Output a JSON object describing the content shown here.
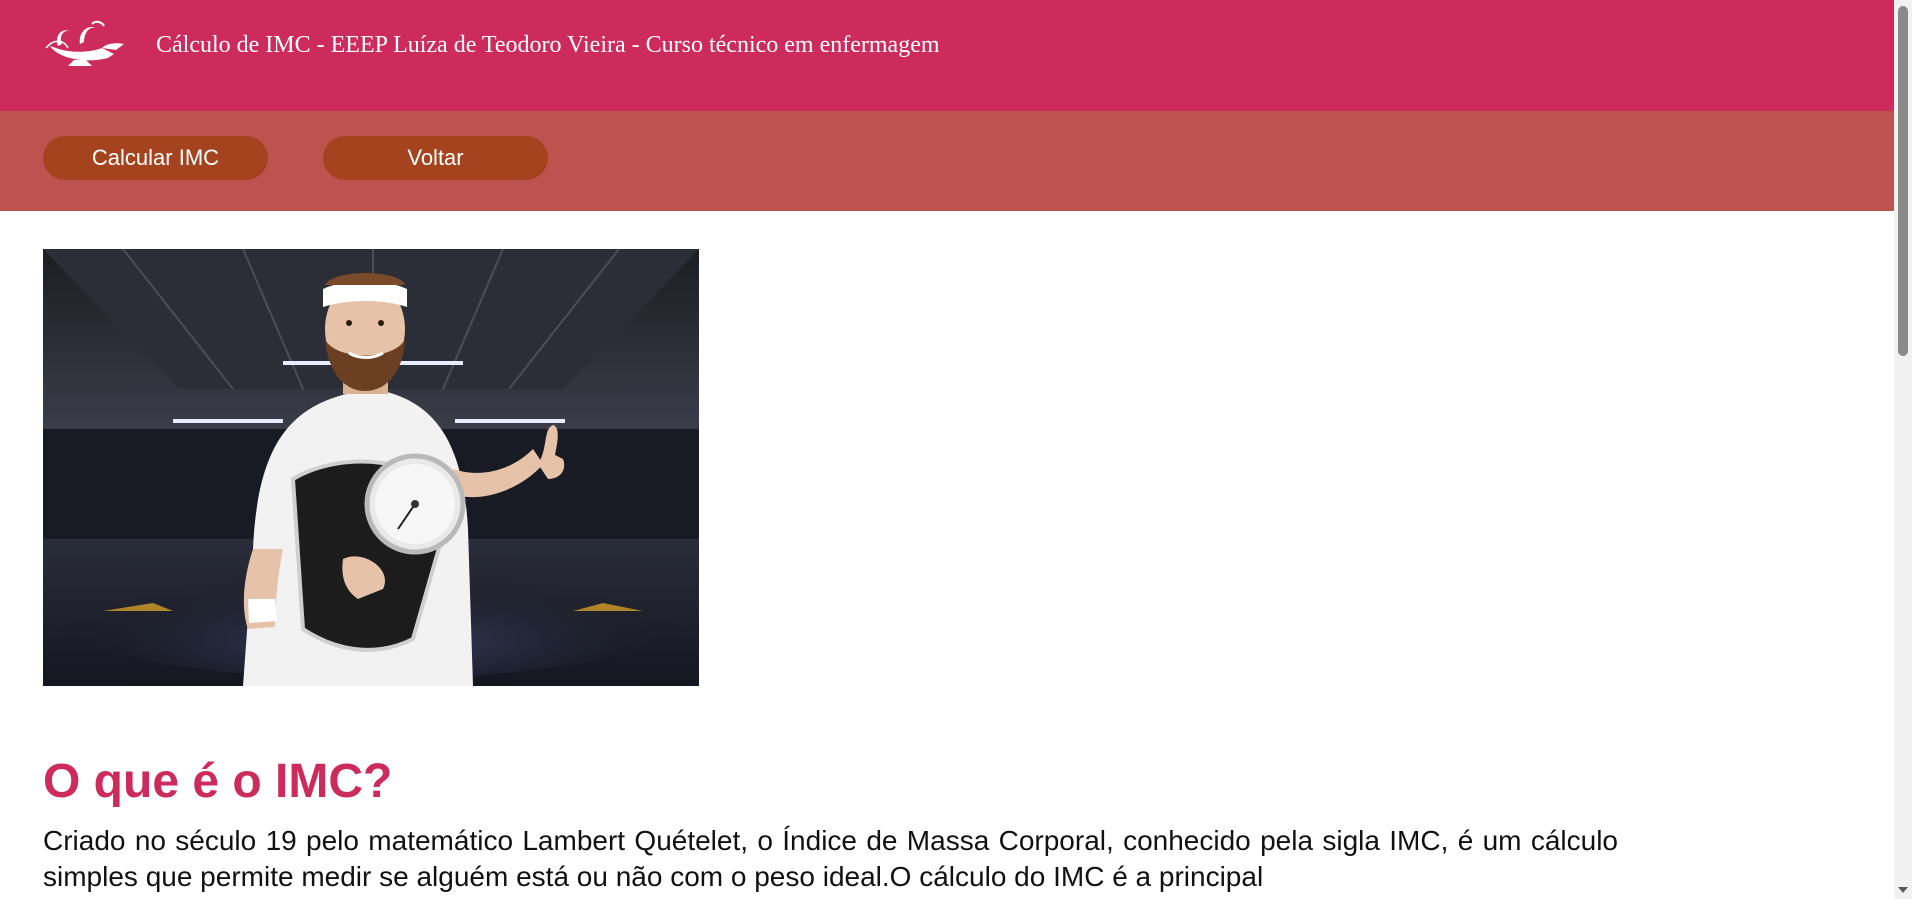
{
  "header": {
    "logo_icon": "nursing-lamp-logo-icon",
    "title": "Cálculo de IMC - EEEP Luíza de Teodoro Vieira - Curso técnico em enfermagem"
  },
  "nav": {
    "calculate_label": "Calcular IMC",
    "back_label": "Voltar"
  },
  "hero": {
    "image_icon": "man-holding-scale-image"
  },
  "content": {
    "heading": "O que é o IMC?",
    "paragraph": "Criado no século 19 pelo matemático Lambert Quételet, o Índice de Massa Corporal, conhecido pela sigla IMC, é um cálculo simples que permite medir se alguém está ou não com o peso ideal.O cálculo do IMC é a principal"
  },
  "colors": {
    "header_bg": "#cc2b5c",
    "nav_bg": "#bc534f",
    "button_bg": "#a4431e",
    "heading": "#cc2b5c"
  }
}
